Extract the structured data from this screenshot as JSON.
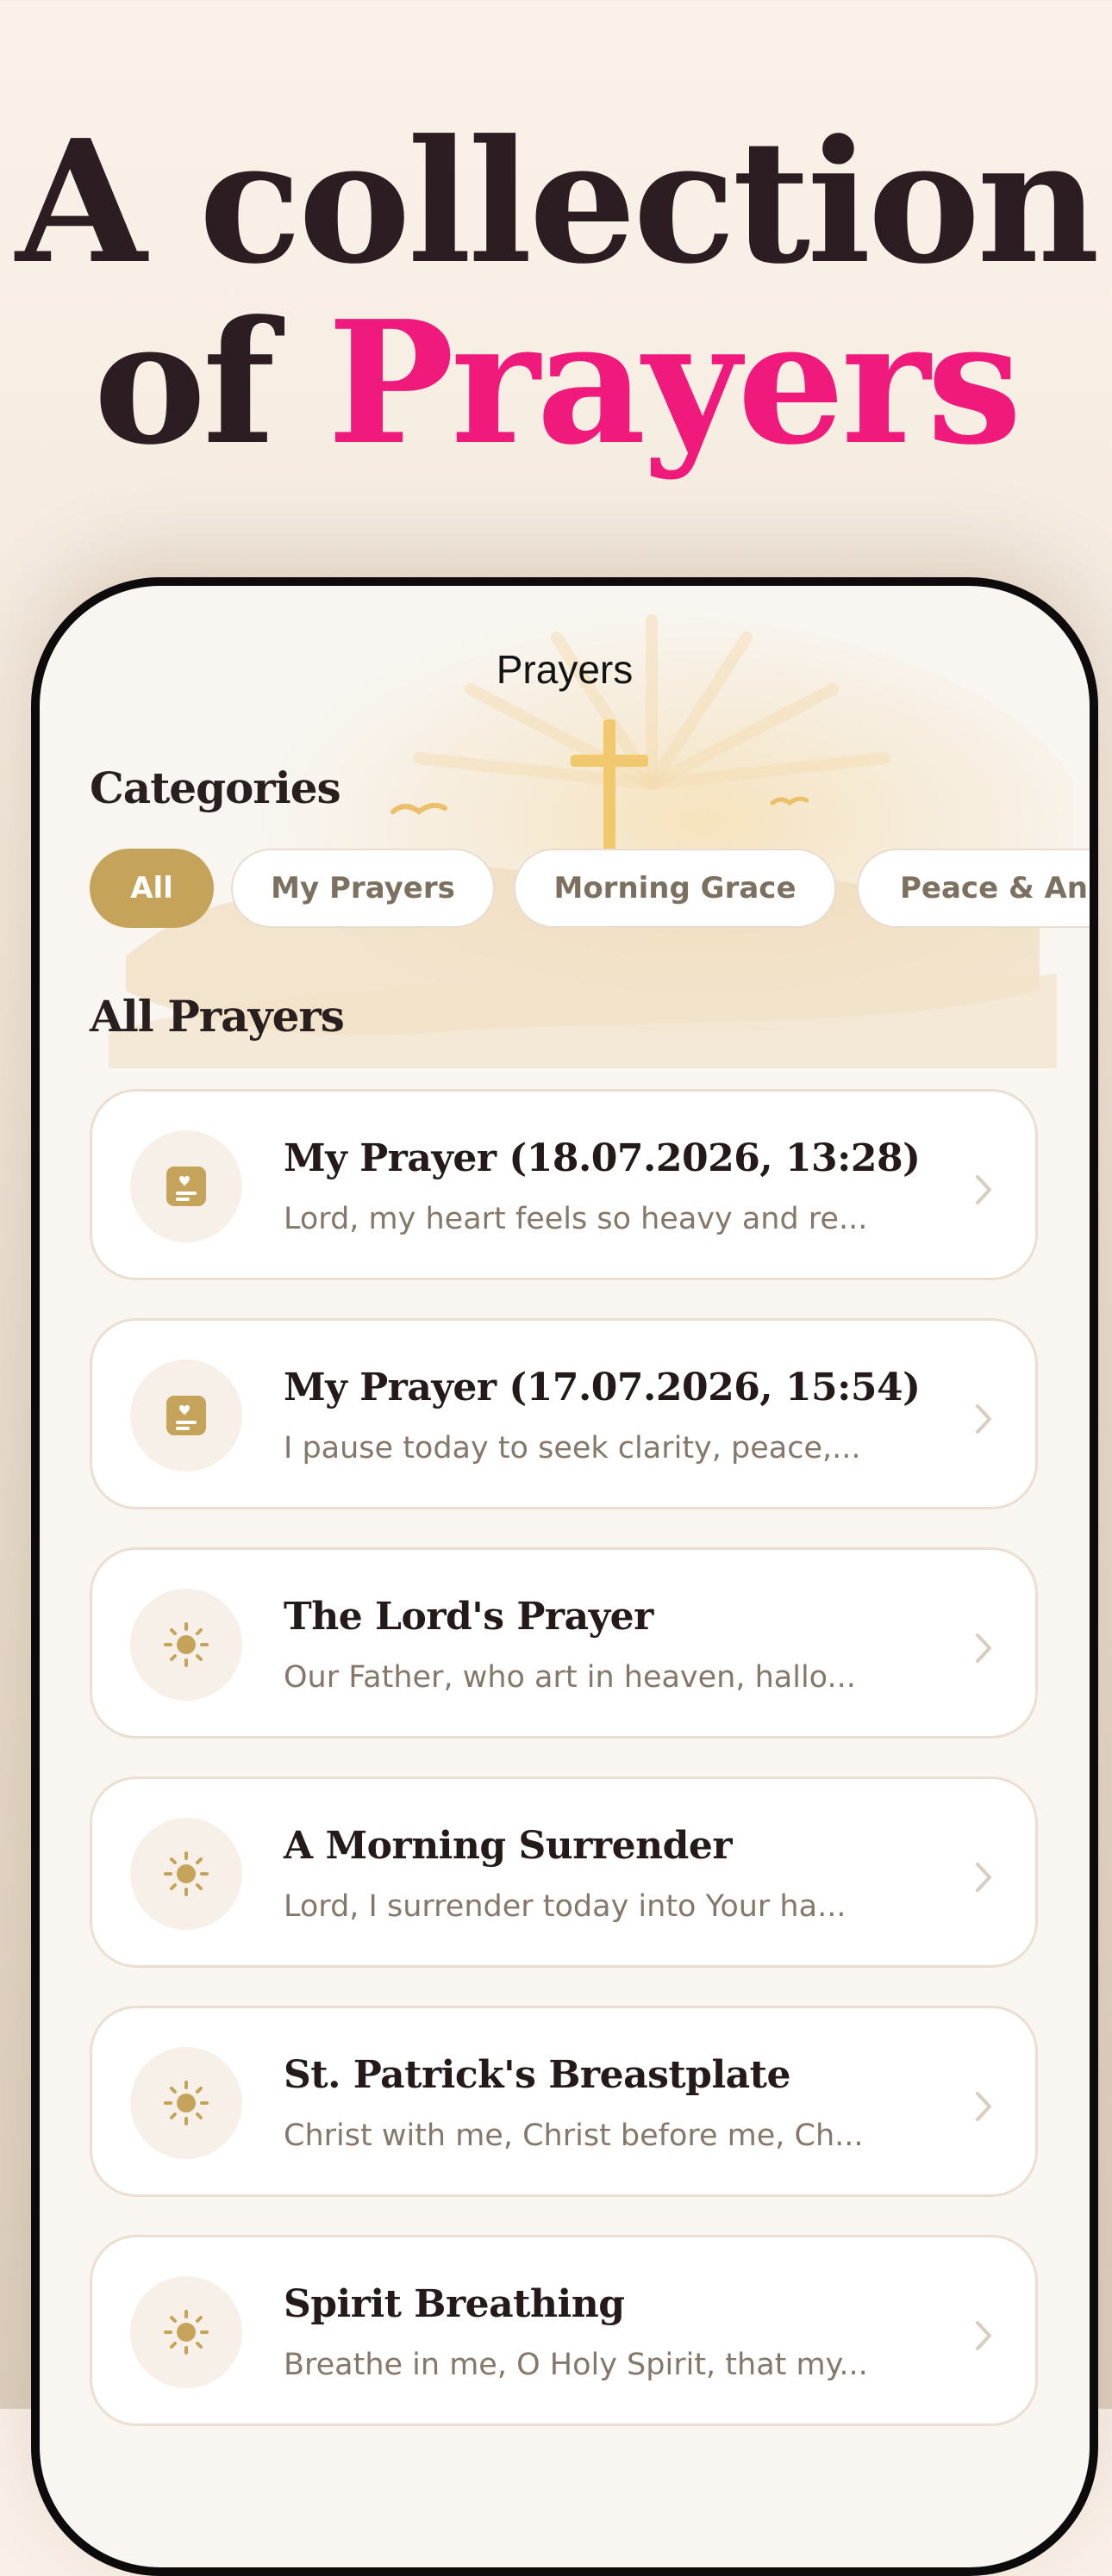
{
  "headline": {
    "line1": "A collection",
    "line2_prefix": "of ",
    "line2_accent": "Prayers"
  },
  "screen": {
    "nav_title": "Prayers",
    "categories_heading": "Categories",
    "categories": [
      {
        "label": "All",
        "selected": true
      },
      {
        "label": "My Prayers",
        "selected": false
      },
      {
        "label": "Morning Grace",
        "selected": false
      },
      {
        "label": "Peace & An",
        "selected": false
      }
    ],
    "list_heading": "All Prayers",
    "prayers": [
      {
        "title": "My Prayer (18.07.2026, 13:28)",
        "preview": "Lord, my heart feels so heavy and re...",
        "icon": "journal-heart-icon"
      },
      {
        "title": "My Prayer (17.07.2026, 15:54)",
        "preview": "I pause today to seek clarity, peace,...",
        "icon": "journal-heart-icon"
      },
      {
        "title": "The Lord's Prayer",
        "preview": "Our Father, who art in heaven, hallo...",
        "icon": "sun-icon"
      },
      {
        "title": "A Morning Surrender",
        "preview": "Lord, I surrender today into Your ha...",
        "icon": "sun-icon"
      },
      {
        "title": "St. Patrick's Breastplate",
        "preview": "Christ with me, Christ before me, Ch...",
        "icon": "sun-icon"
      },
      {
        "title": "Spirit Breathing",
        "preview": "Breathe in me, O Holy Spirit, that my...",
        "icon": "sun-icon"
      }
    ]
  },
  "colors": {
    "accent_pink": "#f01a7c",
    "gold": "#c6a35a",
    "dark_text": "#2b1d22",
    "muted_text": "#85786b"
  }
}
